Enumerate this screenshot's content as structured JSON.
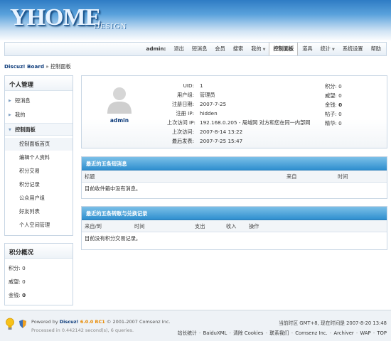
{
  "header": {
    "logo_big": "YHOME",
    "logo_small": "DESIGN"
  },
  "topnav": {
    "user": "admin:",
    "items": [
      "退出",
      "短消息",
      "会员",
      "搜索",
      "我的",
      "控制面板",
      "道具",
      "统计",
      "系统设置",
      "帮助"
    ]
  },
  "breadcrumb": {
    "home": "Discuz! Board",
    "sep": " » ",
    "current": "控制面板"
  },
  "sidebar": {
    "title": "个人管理",
    "groups": [
      "短消息",
      "我的",
      "控制面板"
    ],
    "subitems": [
      "控制面板首页",
      "编辑个人资料",
      "积分交易",
      "积分记录",
      "公众用户组",
      "好友列表",
      "个人空间管理"
    ]
  },
  "credits": {
    "title": "积分概况",
    "rows": [
      {
        "label": "积分:",
        "value": "0",
        "bold": false
      },
      {
        "label": "威望:",
        "value": "0",
        "bold": false
      },
      {
        "label": "金钱:",
        "value": "0",
        "bold": true
      }
    ]
  },
  "profile": {
    "name": "admin",
    "rows": [
      {
        "label": "UID:",
        "value": "1"
      },
      {
        "label": "用户组:",
        "value": "管理员"
      },
      {
        "label": "注册日期:",
        "value": "2007-7-25"
      },
      {
        "label": "注册 IP:",
        "value": "hidden"
      },
      {
        "label": "上次访问 IP:",
        "value": "192.168.0.205 - 局域网  对方和您在同一内部网"
      },
      {
        "label": "上次访问:",
        "value": "2007-8-14 13:22"
      },
      {
        "label": "最后发表:",
        "value": "2007-7-25 15:47"
      }
    ],
    "stats": [
      {
        "label": "积分:",
        "value": "0",
        "bold": false
      },
      {
        "label": "威望:",
        "value": "0",
        "bold": false
      },
      {
        "label": "金钱:",
        "value": "0",
        "bold": true
      },
      {
        "label": "帖子:",
        "value": "0",
        "bold": false
      },
      {
        "label": "精华:",
        "value": "0",
        "bold": false
      }
    ]
  },
  "pm_panel": {
    "title": "最近的五条短消息",
    "columns": [
      "标题",
      "来自",
      "时间"
    ],
    "empty": "目前收件箱中没有消息。"
  },
  "trade_panel": {
    "title": "最近的五条转账与兑换记录",
    "columns": [
      "来自/到",
      "时间",
      "支出",
      "收入",
      "操作"
    ],
    "empty": "目前没有积分交易记录。"
  },
  "footer": {
    "powered_pre": "Powered by ",
    "product": "Discuz!",
    "version": " 6.0.0 RC1",
    "copyright": " © 2001-2007 Comsenz Inc.",
    "processed": "Processed in 0.442142 second(s), 6 queries.",
    "timezone": "当前时区 GMT+8, 现在时间是 2007-8-20 13:48",
    "links": [
      "站长统计",
      "BaiduXML",
      "清除 Cookies",
      "联系我们",
      "Comsenz Inc.",
      "Archiver",
      "WAP",
      "TOP"
    ]
  },
  "colors": {
    "panel_header": "#3a96d2",
    "link": "#0b3a7a",
    "version": "#e88a00"
  }
}
